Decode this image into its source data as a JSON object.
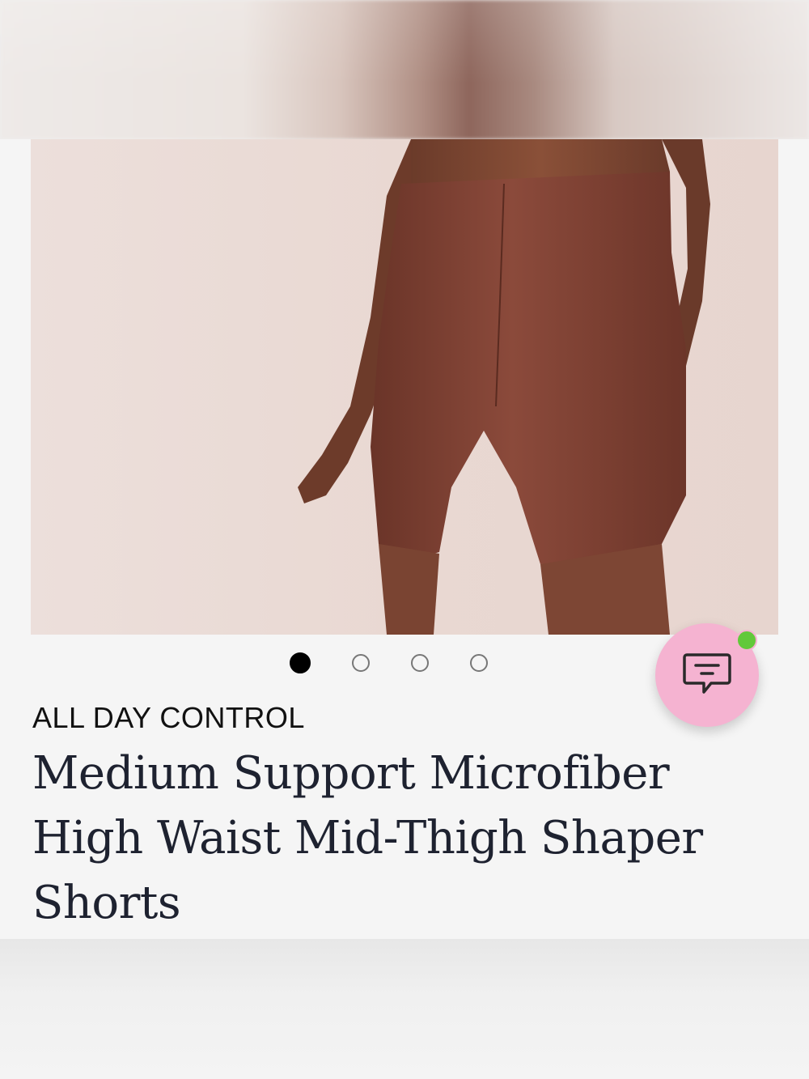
{
  "product": {
    "brand": "ALL DAY CONTROL",
    "title": "Medium Support Microfiber High Waist Mid-Thigh Shaper Shorts",
    "image_alt": "Model wearing brown high waist mid-thigh shaper shorts"
  },
  "carousel": {
    "total": 4,
    "active_index": 0
  },
  "chat": {
    "icon": "chat-icon",
    "online_status_color": "#62c93a",
    "button_color": "#f5b3d1"
  }
}
